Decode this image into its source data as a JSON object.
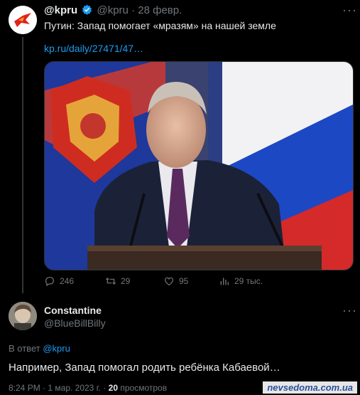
{
  "tweet": {
    "author_name": "@kpru",
    "author_handle": "@kpru",
    "separator": "·",
    "date": "28 февр.",
    "text": "Путин: Запад помогает «мразям» на нашей земле",
    "link": "kp.ru/daily/27471/47…",
    "stats": {
      "replies": "246",
      "retweets": "29",
      "likes": "95",
      "views": "29 тыс."
    }
  },
  "reply": {
    "author_name": "Constantine",
    "author_handle": "@BlueBillBilly",
    "reply_to_prefix": "В ответ",
    "reply_to_mention": "@kpru",
    "text": "Например, Запад помогал родить ребёнка Кабаевой…",
    "time": "8:24 PM",
    "separator": "·",
    "date": "1 мар. 2023 г.",
    "views_count": "20",
    "views_label": "просмотров"
  },
  "watermark": "nevsedoma.com.ua",
  "colors": {
    "background": "#000000",
    "text": "#e7e9ea",
    "muted": "#71767b",
    "accent": "#1d9bf0"
  },
  "icons": [
    "kp-logo-icon",
    "verified-badge-icon",
    "more-icon",
    "reply-icon",
    "retweet-icon",
    "like-icon",
    "views-icon"
  ]
}
